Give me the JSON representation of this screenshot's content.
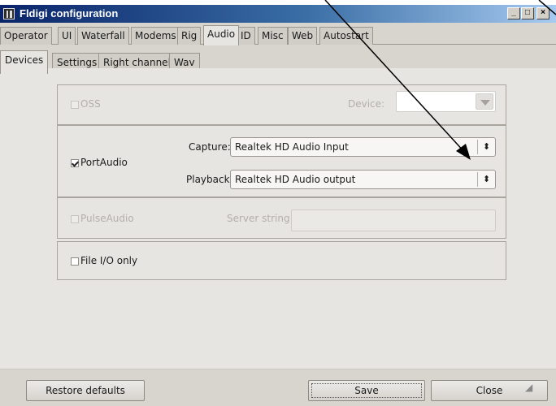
{
  "window": {
    "title": "Fldigi configuration",
    "controls": {
      "minimize": "_",
      "maximize": "□",
      "close": "×"
    }
  },
  "tabs": [
    "Operator",
    "UI",
    "Waterfall",
    "Modems",
    "Rig",
    "Audio",
    "ID",
    "Misc",
    "Web",
    "Autostart"
  ],
  "active_tab": "Audio",
  "subtabs": [
    "Devices",
    "Settings",
    "Right channel",
    "Wav"
  ],
  "active_subtab": "Devices",
  "oss": {
    "label": "OSS",
    "enabled": false,
    "checked": false,
    "device_label": "Device:",
    "device_value": ""
  },
  "portaudio": {
    "label": "PortAudio",
    "checked": true,
    "capture_label": "Capture:",
    "capture_value": "Realtek HD Audio Input",
    "playback_label": "Playback:",
    "playback_value": "Realtek HD Audio output"
  },
  "pulseaudio": {
    "label": "PulseAudio",
    "enabled": false,
    "checked": false,
    "server_label": "Server string:",
    "server_value": ""
  },
  "fileio": {
    "label": "File I/O only",
    "checked": false
  },
  "footer": {
    "restore_label": "Restore defaults",
    "save_label": "Save",
    "close_label": "Close"
  },
  "icons": {
    "spin": "⬍",
    "grip": "◢"
  },
  "colors": {
    "titlebar_start": "#0a246a",
    "titlebar_end": "#a6caf0",
    "panel": "#e7e5e1",
    "annotation": "#000000"
  }
}
